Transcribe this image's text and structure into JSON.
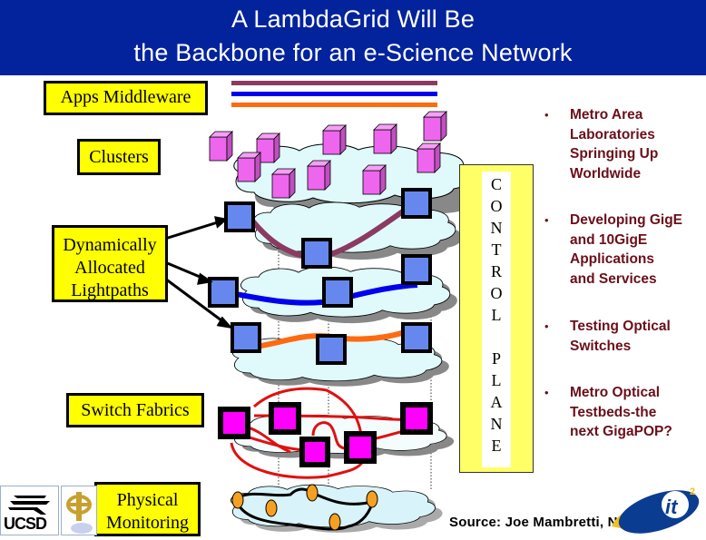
{
  "slide": {
    "title_lines": [
      "A LambdaGrid Will Be",
      "the Backbone for an e-Science Network"
    ],
    "colors": {
      "title_background": "#03239c",
      "title_text": "#ffffff",
      "label_box": "#ffff00",
      "control_plane": "#ffff66",
      "bullet_text": "#6b0f1a",
      "cluster_node": "#ee66ee",
      "lightpath_node": "#6688ee",
      "switch_node": "#ff00ff",
      "monitor_node": "#f5a020",
      "lambda_1": "#8b3a62",
      "lambda_2": "#0000ee",
      "lambda_3": "#ff6a10",
      "switch_links": "#e01010",
      "cloud_fill": "#e0fafc"
    }
  },
  "layers": {
    "apps_middleware": "Apps Middleware",
    "clusters": "Clusters",
    "lightpaths": [
      "Dynamically",
      "Allocated",
      "Lightpaths"
    ],
    "switch_fabrics": "Switch Fabrics",
    "physical_monitoring": [
      "Physical",
      "Monitoring"
    ]
  },
  "control_plane": {
    "word1": [
      "C",
      "O",
      "N",
      "T",
      "R",
      "O",
      "L"
    ],
    "word2": [
      "P",
      "L",
      "A",
      "N",
      "E"
    ]
  },
  "bullets": [
    {
      "marker": "•",
      "lines": [
        "Metro Area",
        "Laboratories",
        "Springing Up",
        "Worldwide"
      ]
    },
    {
      "marker": "•",
      "lines": [
        "Developing GigE",
        "and 10GigE",
        "Applications",
        "and Services"
      ]
    },
    {
      "marker": "•",
      "lines": [
        "Testing Optical",
        "Switches"
      ]
    },
    {
      "marker": "•",
      "lines": [
        "Metro Optical",
        "Testbeds-the",
        "next GigaPOP?"
      ]
    }
  ],
  "source": "Source: Joe Mambretti, NU",
  "logos": {
    "ucsd": "UCSD",
    "uc_seal": "uc-seal-logo",
    "it2": "it2"
  }
}
